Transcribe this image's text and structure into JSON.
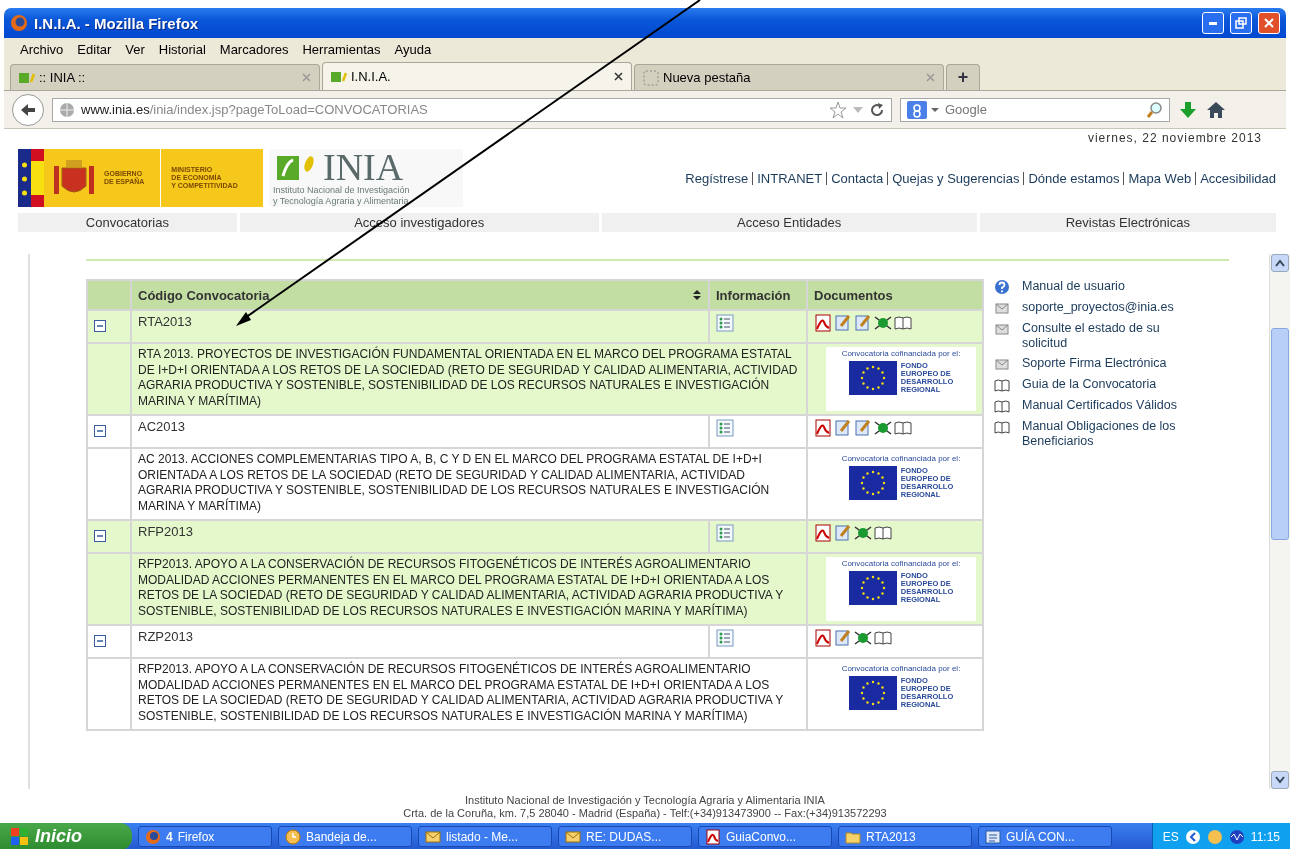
{
  "window": {
    "title": "I.N.I.A. - Mozilla Firefox"
  },
  "menu": [
    "Archivo",
    "Editar",
    "Ver",
    "Historial",
    "Marcadores",
    "Herramientas",
    "Ayuda"
  ],
  "tabs": [
    {
      "label": ":: INIA ::",
      "selected": false
    },
    {
      "label": "I.N.I.A.",
      "selected": true
    },
    {
      "label": "Nueva pestaña",
      "selected": false
    }
  ],
  "new_tab_button": "+",
  "address_bar": {
    "url_host": "www.inia.es",
    "url_rest": "/inia/index.jsp?pageToLoad=CONVOCATORIAS"
  },
  "search": {
    "placeholder": "Google"
  },
  "page": {
    "date": "viernes, 22 noviembre 2013",
    "gov_logo": {
      "line1": "GOBIERNO",
      "line2": "DE ESPAÑA",
      "ministry1": "MINISTERIO",
      "ministry2": "DE ECONOMÍA",
      "ministry3": "Y COMPETITIVIDAD"
    },
    "inia_logo": {
      "name": "INIA",
      "line1": "Instituto Nacional de Investigación",
      "line2": "y Tecnología Agraria y Alimentaria"
    },
    "top_links": [
      "Regístrese",
      "INTRANET",
      "Contacta",
      "Quejas y Sugerencias",
      "Dónde estamos",
      "Mapa Web",
      "Accesibilidad"
    ],
    "nav": [
      "Convocatorias",
      "Acceso investigadores",
      "Acceso Entidades",
      "Revistas Electrónicas"
    ],
    "table": {
      "columns": [
        "Código Convocatoria",
        "Información",
        "Documentos"
      ],
      "rows": [
        {
          "code": "RTA2013",
          "expanded": true,
          "documents": [
            {
              "kind": "pdf"
            },
            {
              "kind": "edit"
            },
            {
              "kind": "edit"
            },
            {
              "kind": "network"
            },
            {
              "kind": "book"
            }
          ],
          "funding": {
            "caption": "Convocatoria cofinanciada por el:",
            "line1": "FONDO",
            "line2": "EUROPEO DE",
            "line3": "DESARROLLO",
            "line4": "REGIONAL"
          },
          "description": "RTA 2013. PROYECTOS DE INVESTIGACIÓN FUNDAMENTAL ORIENTADA EN EL MARCO DEL PROGRAMA ESTATAL DE I+D+I ORIENTADA A LOS RETOS DE LA SOCIEDAD (RETO DE SEGURIDAD Y CALIDAD ALIMENTARIA, ACTIVIDAD AGRARIA PRODUCTIVA Y SOSTENIBLE, SOSTENIBILIDAD DE LOS RECURSOS NATURALES E INVESTIGACIÓN MARINA Y MARÍTIMA)"
        },
        {
          "code": "AC2013",
          "expanded": true,
          "documents": [
            {
              "kind": "pdf"
            },
            {
              "kind": "edit"
            },
            {
              "kind": "edit"
            },
            {
              "kind": "network"
            },
            {
              "kind": "book"
            }
          ],
          "funding": {
            "caption": "Convocatoria cofinanciada por el:",
            "line1": "FONDO",
            "line2": "EUROPEO DE",
            "line3": "DESARROLLO",
            "line4": "REGIONAL"
          },
          "description": "AC 2013. ACCIONES COMPLEMENTARIAS TIPO A, B, C Y D EN EL MARCO DEL PROGRAMA ESTATAL DE I+D+I ORIENTADA A LOS RETOS DE LA SOCIEDAD (RETO DE SEGURIDAD Y CALIDAD ALIMENTARIA, ACTIVIDAD AGRARIA PRODUCTIVA Y SOSTENIBLE, SOSTENIBILIDAD DE LOS RECURSOS NATURALES E INVESTIGACIÓN MARINA Y MARÍTIMA)"
        },
        {
          "code": "RFP2013",
          "expanded": true,
          "documents": [
            {
              "kind": "pdf"
            },
            {
              "kind": "edit"
            },
            {
              "kind": "network"
            },
            {
              "kind": "book"
            }
          ],
          "funding": {
            "caption": "Convocatoria cofinanciada por el:",
            "line1": "FONDO",
            "line2": "EUROPEO DE",
            "line3": "DESARROLLO",
            "line4": "REGIONAL"
          },
          "description": "RFP2013. APOYO A LA CONSERVACIÓN DE RECURSOS FITOGENÉTICOS DE INTERÉS AGROALIMENTARIO MODALIDAD ACCIONES PERMANENTES EN EL MARCO DEL PROGRAMA ESTATAL DE I+D+I ORIENTADA A LOS RETOS DE LA SOCIEDAD (RETO DE SEGURIDAD Y CALIDAD ALIMENTARIA, ACTIVIDAD AGRARIA PRODUCTIVA Y SOSTENIBLE, SOSTENIBILIDAD DE LOS RECURSOS NATURALES E INVESTIGACIÓN MARINA Y MARÍTIMA)"
        },
        {
          "code": "RZP2013",
          "expanded": true,
          "documents": [
            {
              "kind": "pdf"
            },
            {
              "kind": "edit"
            },
            {
              "kind": "network"
            },
            {
              "kind": "book"
            }
          ],
          "funding": {
            "caption": "Convocatoria cofinanciada por el:",
            "line1": "FONDO",
            "line2": "EUROPEO DE",
            "line3": "DESARROLLO",
            "line4": "REGIONAL"
          },
          "description": "RFP2013. APOYO A LA CONSERVACIÓN DE RECURSOS FITOGENÉTICOS DE INTERÉS AGROALIMENTARIO MODALIDAD ACCIONES PERMANENTES EN EL MARCO DEL PROGRAMA ESTATAL DE I+D+I ORIENTADA A LOS RETOS DE LA SOCIEDAD (RETO DE SEGURIDAD Y CALIDAD ALIMENTARIA, ACTIVIDAD AGRARIA PRODUCTIVA Y SOSTENIBLE, SOSTENIBILIDAD DE LOS RECURSOS NATURALES E INVESTIGACIÓN MARINA Y MARÍTIMA)"
        }
      ]
    },
    "sidebar": [
      {
        "kind": "help",
        "label": "Manual de usuario"
      },
      {
        "kind": "mail",
        "label": "soporte_proyectos@inia.es"
      },
      {
        "kind": "mail",
        "label": "Consulte el estado de su solicitud"
      },
      {
        "kind": "mail",
        "label": "Soporte Firma Electrónica"
      },
      {
        "kind": "book",
        "label": "Guia de la Convocatoria"
      },
      {
        "kind": "book",
        "label": "Manual Certificados Válidos"
      },
      {
        "kind": "book",
        "label": "Manual Obligaciones de los Beneficiarios"
      }
    ],
    "footer": [
      "Instituto Nacional de Investigación y Tecnología Agraria y Alimentaria INIA",
      "Crta. de la Coruña, km. 7,5 28040 - Madrid (España) - Telf:(+34)913473900 -- Fax:(+34)913572293"
    ]
  },
  "taskbar": {
    "start": "Inicio",
    "items": [
      {
        "kind": "firefox",
        "count": "4",
        "label": "Firefox"
      },
      {
        "kind": "mail-app",
        "label": "Bandeja de..."
      },
      {
        "kind": "mail",
        "label": "listado - Me..."
      },
      {
        "kind": "mail",
        "label": "RE: DUDAS..."
      },
      {
        "kind": "pdf",
        "label": "GuiaConvo..."
      },
      {
        "kind": "folder",
        "label": "RTA2013"
      },
      {
        "kind": "doc",
        "label": "GUÍA CON..."
      }
    ],
    "language": "ES",
    "time": "11:15"
  }
}
